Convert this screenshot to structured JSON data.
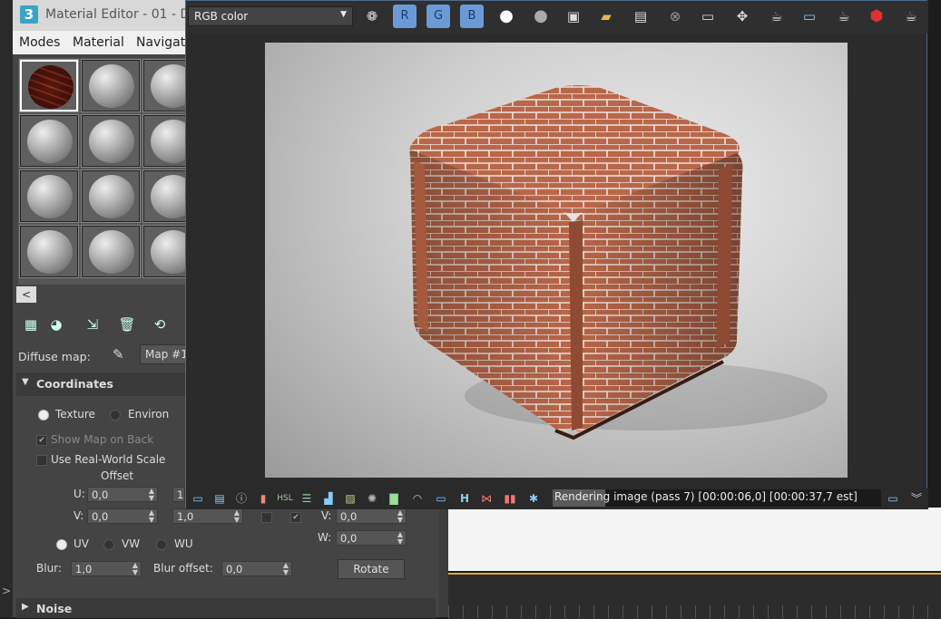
{
  "material_editor": {
    "title": "Material Editor - 01 - D",
    "logo": "3",
    "menu": [
      "Modes",
      "Material",
      "Navigat"
    ],
    "collapse_glyph": "<",
    "diffuse_label": "Diffuse map:",
    "map_button": "Map #1",
    "coordinates": {
      "header": "Coordinates",
      "texture_label": "Texture",
      "environ_label": "Environ",
      "show_map_on_back": "Show Map on Back",
      "use_real_world_scale": "Use Real-World Scale",
      "offset_label": "Offset",
      "u_label": "U:",
      "v_label": "V:",
      "u_offset": "0,0",
      "v_offset": "0,0",
      "u_tiling": "1",
      "v_tiling": "1,0",
      "v_angle_label": "V:",
      "w_angle_label": "W:",
      "v_angle": "0,0",
      "w_angle": "0,0",
      "uv_label": "UV",
      "vw_label": "VW",
      "wu_label": "WU",
      "blur_label": "Blur:",
      "blur_value": "1,0",
      "blur_offset_label": "Blur offset:",
      "blur_offset_value": "0,0",
      "rotate_label": "Rotate"
    },
    "noise_header": "Noise"
  },
  "frame_buffer": {
    "channel": "RGB color",
    "r_label": "R",
    "g_label": "G",
    "b_label": "B",
    "status": "Rendering image (pass 7) [00:00:06,0] [00:00:37,7 est]",
    "progress": 0.16
  },
  "colors": {
    "accent_blue": "#6a9bd8",
    "stop_red": "#d33",
    "brick": "#b8674a"
  }
}
